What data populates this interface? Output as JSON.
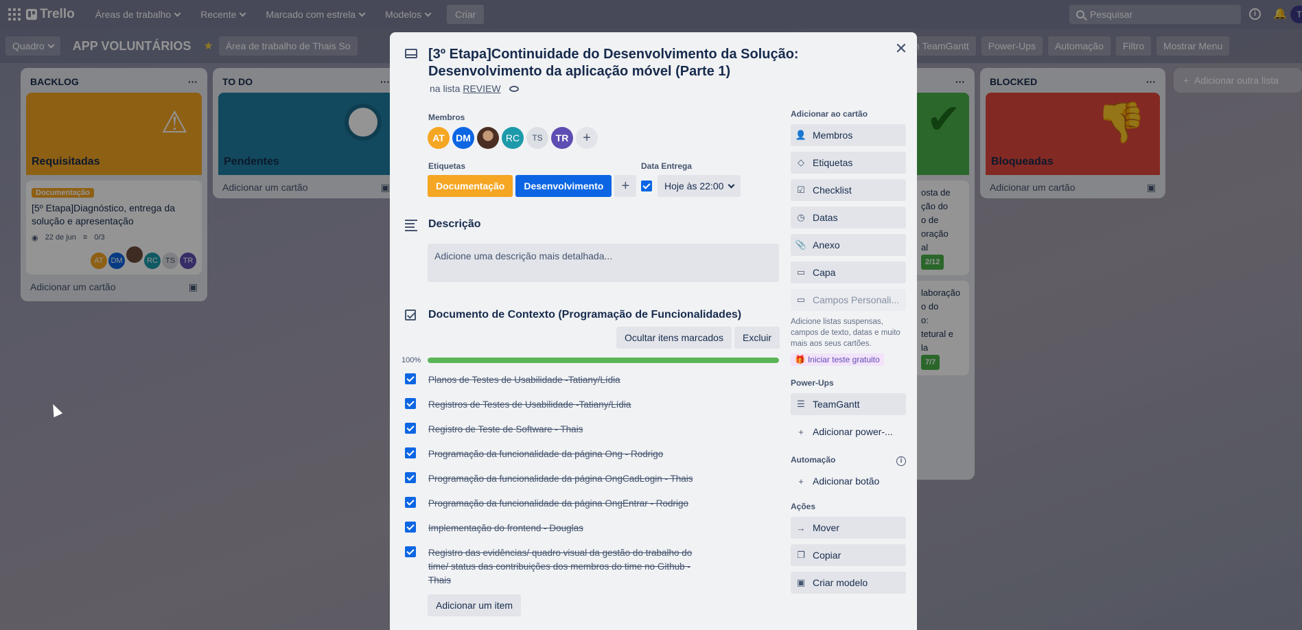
{
  "topbar": {
    "logo": "Trello",
    "nav": [
      "Áreas de trabalho",
      "Recente",
      "Marcado com estrela",
      "Modelos"
    ],
    "create": "Criar",
    "search_placeholder": "Pesquisar"
  },
  "boardbar": {
    "view": "Quadro",
    "title": "APP VOLUNTÁRIOS",
    "workspace": "Área de trabalho de Thais So",
    "teamgantt": "th TeamGantt",
    "powerups": "Power-Ups",
    "automation": "Automação",
    "filter": "Filtro",
    "show_menu": "Mostrar Menu"
  },
  "lists": {
    "backlog": {
      "title": "BACKLOG",
      "cover": "Requisitadas",
      "card_label": "Documentação",
      "card_title": "[5º Etapa]Diagnóstico, entrega da solução e apresentação",
      "card_date": "22 de jun",
      "card_checklist": "0/3",
      "add": "Adicionar um cartão"
    },
    "todo": {
      "title": "TO DO",
      "cover": "Pendentes",
      "add": "Adicionar um cartão"
    },
    "blocked": {
      "title": "BLOCKED",
      "cover": "Bloqueadas",
      "add": "Adicionar um cartão"
    },
    "done_partial": {
      "card1_lines": [
        "osta de",
        "ção do",
        "o de",
        "oração",
        "al"
      ],
      "card1_badge": "2/12",
      "card2_lines": [
        "laboração",
        "o do",
        "o:",
        "tetural e",
        "la"
      ],
      "card2_badge": "7/7"
    },
    "add_list": "Adicionar outra lista"
  },
  "members": [
    "AT",
    "DM",
    "",
    "RC",
    "TS",
    "TR"
  ],
  "modal": {
    "title": "[3º Etapa]Continuidade do Desenvolvimento da Solução: Desenvolvimento da aplicação móvel (Parte 1)",
    "in_list_prefix": "na lista",
    "in_list_name": "REVIEW",
    "members_label": "Membros",
    "labels_label": "Etiquetas",
    "labels": [
      "Documentação",
      "Desenvolvimento"
    ],
    "due_label": "Data Entrega",
    "due_value": "Hoje às 22:00",
    "description_title": "Descrição",
    "description_placeholder": "Adicione uma descrição mais detalhada...",
    "checklist_title": "Documento de Contexto (Programação de Funcionalidades)",
    "hide_checked": "Ocultar itens marcados",
    "delete": "Excluir",
    "progress_text": "100%",
    "progress": 1.0,
    "items": [
      "Planos de Testes de Usabilidade -Tatiany/Lídia",
      "Registros de Testes de Usabilidade -Tatiany/Lídia",
      "Registro de Teste de Software - Thais",
      "Programação da funcionalidade da página Ong - Rodrigo",
      "Programação da funcionalidade da página OngCadLogin - Thais",
      "Programação da funcionalidade da página OngEntrar - Rodrigo",
      "Implementação do frontend - Douglas",
      "Registro das evidências/ quadro visual da gestão do trabalho do time/ status das contribuições dos membros do time no Github - Thais"
    ],
    "add_item": "Adicionar um item"
  },
  "sidebar": {
    "add_to_card": "Adicionar ao cartão",
    "buttons": [
      "Membros",
      "Etiquetas",
      "Checklist",
      "Datas",
      "Anexo",
      "Capa"
    ],
    "custom_fields": "Campos Personali...",
    "note": "Adicione listas suspensas, campos de texto, datas e muito mais aos seus cartões.",
    "trial": "Iniciar teste gratuito",
    "powerups_label": "Power-Ups",
    "teamgantt": "TeamGantt",
    "add_powerup": "Adicionar power-...",
    "automation_label": "Automação",
    "add_button": "Adicionar botão",
    "actions_label": "Ações",
    "actions": [
      "Mover",
      "Copiar",
      "Criar modelo"
    ]
  },
  "colors": {
    "label_doc": "#f5a623",
    "label_dev": "#0c66e4",
    "progress": "#5ab556",
    "cover_backlog": "#f5a623",
    "cover_todo": "#1f7fa3",
    "cover_blocked": "#e2483d",
    "cover_done": "#4bb14a"
  }
}
